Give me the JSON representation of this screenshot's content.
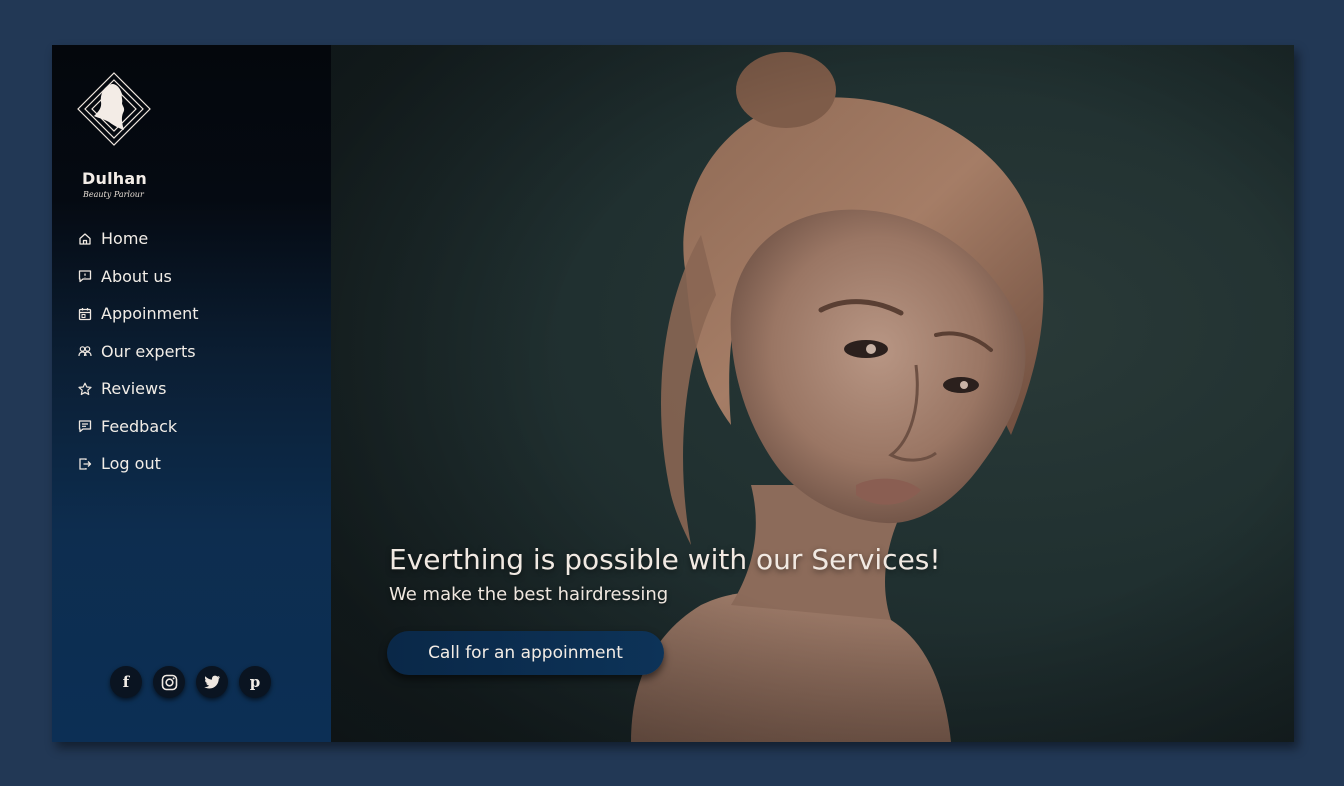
{
  "brand": {
    "name": "Dulhan",
    "tagline": "Beauty Parlour",
    "logo_icon": "woman-silhouette-diamond-icon"
  },
  "nav": {
    "items": [
      {
        "label": "Home",
        "icon": "home-icon"
      },
      {
        "label": "About us",
        "icon": "info-message-icon"
      },
      {
        "label": "Appoinment",
        "icon": "calendar-icon"
      },
      {
        "label": "Our experts",
        "icon": "users-icon"
      },
      {
        "label": "Reviews",
        "icon": "star-icon"
      },
      {
        "label": "Feedback",
        "icon": "chat-icon"
      },
      {
        "label": "Log out",
        "icon": "logout-icon"
      }
    ]
  },
  "socials": [
    {
      "name": "facebook-icon",
      "glyph": "f"
    },
    {
      "name": "instagram-icon",
      "glyph": ""
    },
    {
      "name": "twitter-icon",
      "glyph": ""
    },
    {
      "name": "pinterest-icon",
      "glyph": "p"
    }
  ],
  "hero": {
    "headline": "Everthing is possible with our Services!",
    "subline": "We make the best hairdressing",
    "cta_label": "Call for an appoinment"
  },
  "colors": {
    "page_background": "#223855",
    "sidebar_top": "#04070c",
    "sidebar_bottom": "#0c2f55",
    "text": "#f1ebe4",
    "cta_background": "#0a2848"
  }
}
